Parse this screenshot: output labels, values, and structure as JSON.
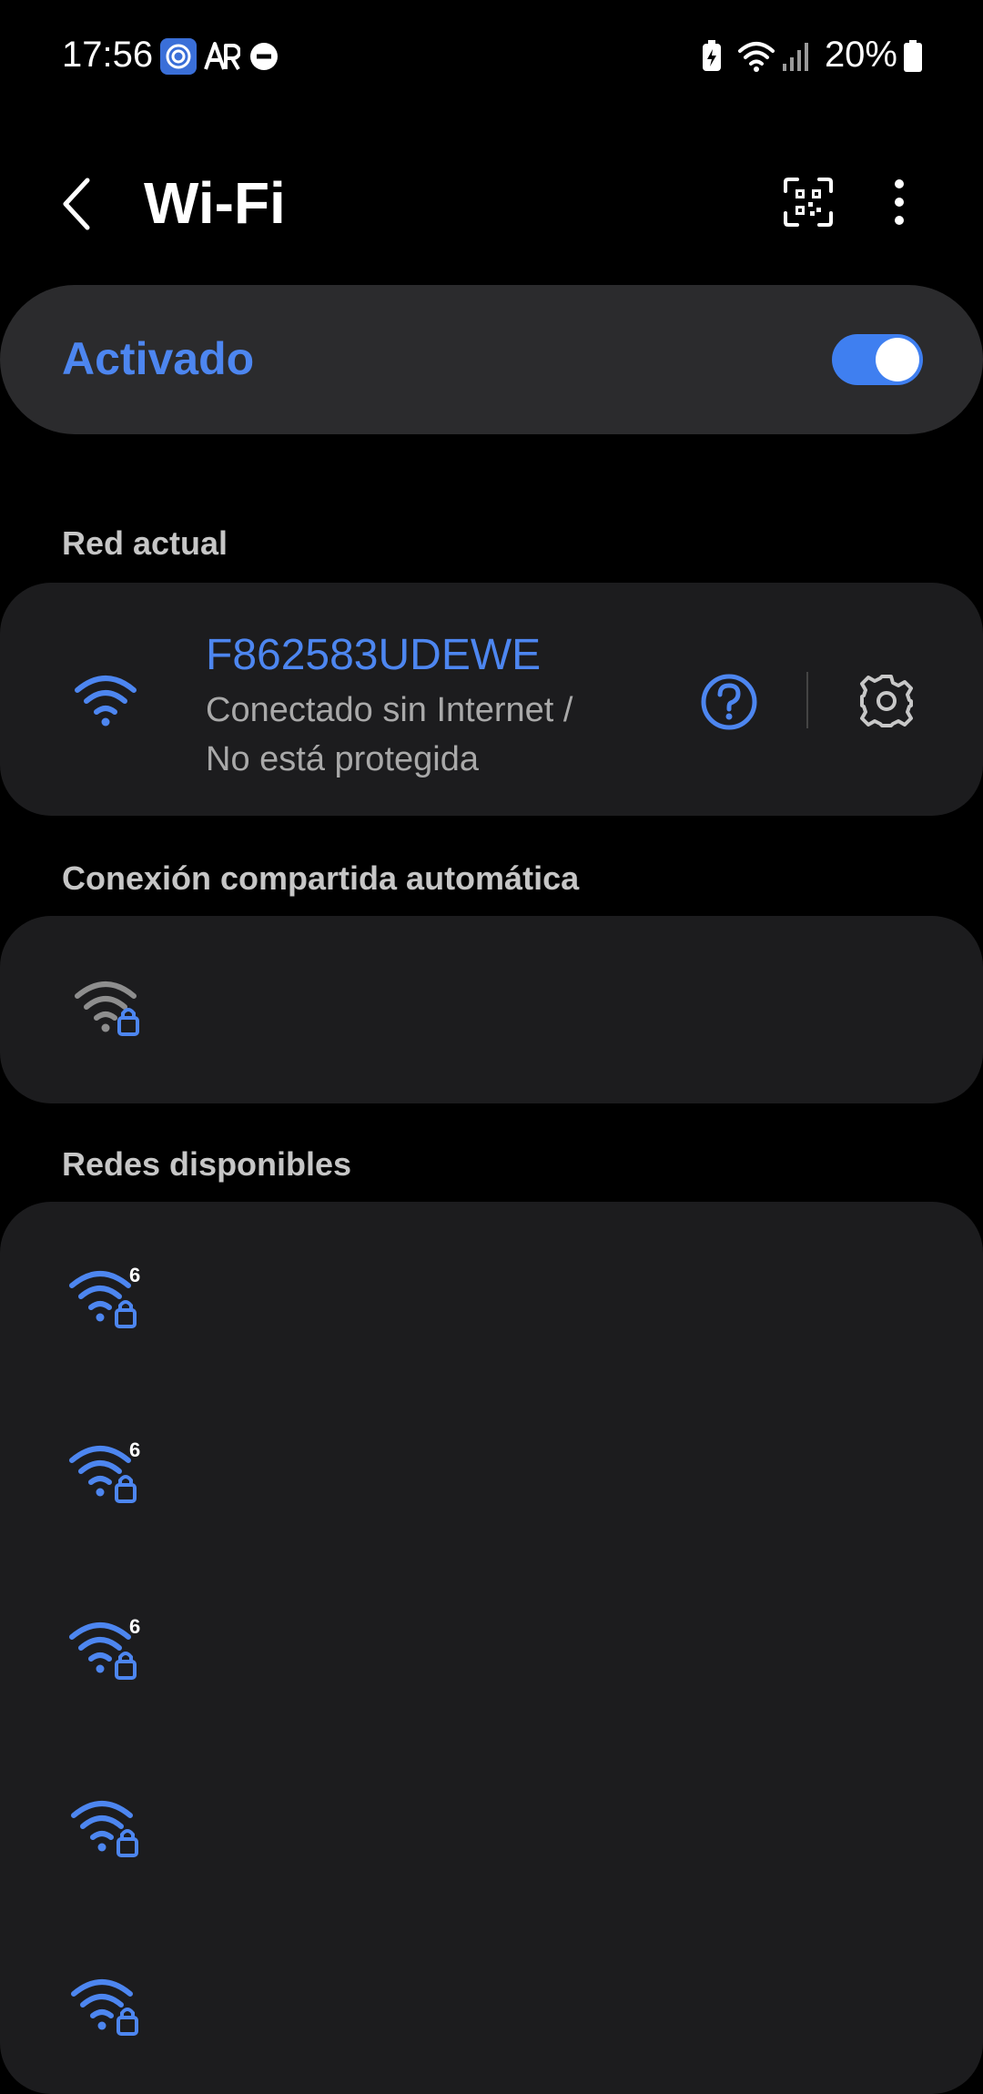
{
  "status_bar": {
    "time": "17:56",
    "battery_percent": "20%",
    "left_icons": [
      "app-notification-icon",
      "ar-icon",
      "do-not-disturb-icon"
    ],
    "right_icons": [
      "battery-saver-icon",
      "wifi-signal-icon",
      "cell-signal-icon",
      "battery-icon"
    ]
  },
  "header": {
    "title": "Wi-Fi",
    "back_icon": "back-arrow-icon",
    "qr_icon": "qr-scan-icon",
    "menu_icon": "more-vert-icon"
  },
  "master_toggle": {
    "label": "Activado",
    "on": true
  },
  "current_network": {
    "section_label": "Red actual",
    "name": "F862583UDEWE",
    "status_line1": "Conectado sin Internet /",
    "status_line2": "No está protegida",
    "icons": [
      "wifi-icon",
      "help-icon",
      "settings-gear-icon"
    ]
  },
  "auto_hotspot": {
    "section_label": "Conexión compartida automática",
    "items": [
      {
        "icon": "wifi-locked-icon",
        "name": ""
      }
    ]
  },
  "available_networks": {
    "section_label": "Redes disponibles",
    "items": [
      {
        "icon": "wifi6-locked-icon",
        "name": ""
      },
      {
        "icon": "wifi6-locked-icon",
        "name": ""
      },
      {
        "icon": "wifi6-locked-icon",
        "name": ""
      },
      {
        "icon": "wifi-locked-icon",
        "name": ""
      },
      {
        "icon": "wifi-locked-icon",
        "name": ""
      }
    ]
  },
  "colors": {
    "accent": "#4d86f0",
    "card_background": "#1c1c1e",
    "background": "#000000"
  }
}
